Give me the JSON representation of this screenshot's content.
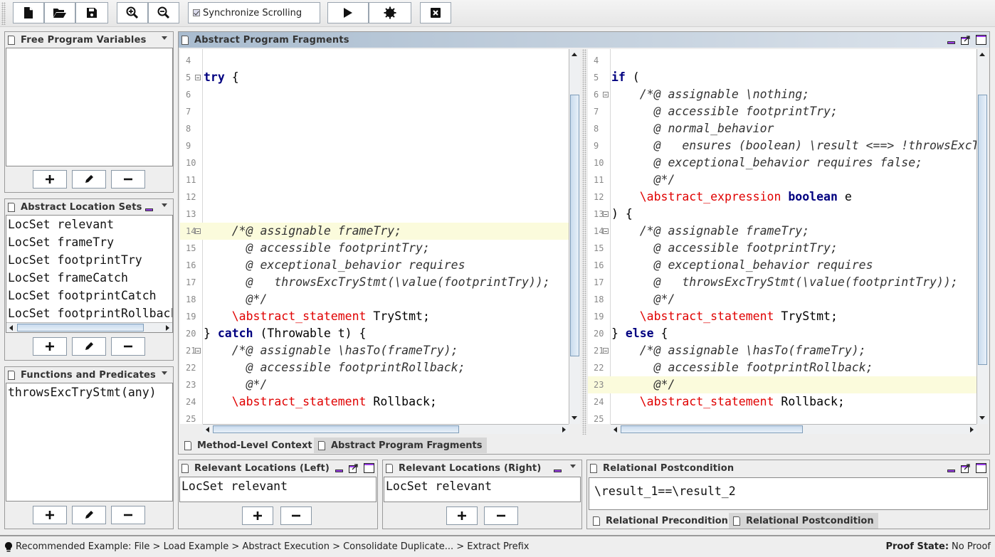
{
  "toolbar": {
    "buttons": [
      {
        "name": "new-file",
        "icon": "file-icon"
      },
      {
        "name": "open",
        "icon": "folder-open-icon"
      },
      {
        "name": "save",
        "icon": "floppy-disk-icon"
      },
      {
        "name": "zoom-in",
        "icon": "zoom-in-icon"
      },
      {
        "name": "zoom-out",
        "icon": "zoom-out-icon"
      },
      {
        "name": "run",
        "icon": "play-icon"
      },
      {
        "name": "settings",
        "icon": "cog-icon"
      },
      {
        "name": "close",
        "icon": "close-box-icon"
      }
    ],
    "sync_label": "Synchronize Scrolling",
    "sync_checked": true
  },
  "left": {
    "free_vars": {
      "title": "Free Program Variables",
      "items": []
    },
    "loc_sets": {
      "title": "Abstract Location Sets",
      "items": [
        "LocSet relevant",
        "LocSet frameTry",
        "LocSet footprintTry",
        "LocSet frameCatch",
        "LocSet footprintCatch",
        "LocSet footprintRollback"
      ]
    },
    "functions": {
      "title": "Functions and Predicates",
      "items": [
        "throwsExcTryStmt(any)"
      ]
    }
  },
  "main": {
    "title": "Abstract Program Fragments",
    "left_editor": {
      "lines": [
        {
          "n": "4",
          "code": []
        },
        {
          "n": "5",
          "fold": true,
          "code": [
            [
              "kw",
              "try"
            ],
            [
              "",
              "{"
            ]
          ]
        },
        {
          "n": "6",
          "code": []
        },
        {
          "n": "7",
          "code": []
        },
        {
          "n": "8",
          "code": []
        },
        {
          "n": "9",
          "code": []
        },
        {
          "n": "10",
          "code": []
        },
        {
          "n": "11",
          "code": []
        },
        {
          "n": "12",
          "code": []
        },
        {
          "n": "13",
          "code": []
        },
        {
          "n": "14",
          "fold": true,
          "hl": true,
          "code": [
            [
              "cm",
              "    /*@ assignable frameTry;"
            ]
          ]
        },
        {
          "n": "15",
          "code": [
            [
              "cm",
              "      @ accessible footprintTry;"
            ]
          ]
        },
        {
          "n": "16",
          "code": [
            [
              "cm",
              "      @ exceptional_behavior requires"
            ]
          ]
        },
        {
          "n": "17",
          "code": [
            [
              "cm",
              "      @   throwsExcTryStmt(\\value(footprintTry));"
            ]
          ]
        },
        {
          "n": "18",
          "code": [
            [
              "cm",
              "      @*/"
            ]
          ]
        },
        {
          "n": "19",
          "code": [
            [
              "ab",
              "    \\abstract_statement"
            ],
            [
              "",
              " TryStmt;"
            ]
          ]
        },
        {
          "n": "20",
          "code": [
            [
              "",
              "} "
            ],
            [
              "kw",
              "catch"
            ],
            [
              "",
              " (Throwable t) {"
            ]
          ]
        },
        {
          "n": "21",
          "fold": true,
          "code": [
            [
              "cm",
              "    /*@ assignable \\hasTo(frameTry);"
            ]
          ]
        },
        {
          "n": "22",
          "code": [
            [
              "cm",
              "      @ accessible footprintRollback;"
            ]
          ]
        },
        {
          "n": "23",
          "code": [
            [
              "cm",
              "      @*/"
            ]
          ]
        },
        {
          "n": "24",
          "code": [
            [
              "ab",
              "    \\abstract_statement"
            ],
            [
              "",
              " Rollback;"
            ]
          ]
        },
        {
          "n": "25",
          "code": []
        }
      ]
    },
    "right_editor": {
      "lines": [
        {
          "n": "4",
          "code": []
        },
        {
          "n": "5",
          "code": [
            [
              "kw",
              "if"
            ],
            [
              "",
              " ("
            ]
          ]
        },
        {
          "n": "6",
          "fold": true,
          "code": [
            [
              "cm",
              "    /*@ assignable \\nothing;"
            ]
          ]
        },
        {
          "n": "7",
          "code": [
            [
              "cm",
              "      @ accessible footprintTry;"
            ]
          ]
        },
        {
          "n": "8",
          "code": [
            [
              "cm",
              "      @ normal_behavior"
            ]
          ]
        },
        {
          "n": "9",
          "code": [
            [
              "cm",
              "      @   ensures (boolean) \\result <==> !throwsExcTryStmt"
            ]
          ]
        },
        {
          "n": "10",
          "code": [
            [
              "cm",
              "      @ exceptional_behavior requires false;"
            ]
          ]
        },
        {
          "n": "11",
          "code": [
            [
              "cm",
              "      @*/"
            ]
          ]
        },
        {
          "n": "12",
          "code": [
            [
              "ab",
              "    \\abstract_expression"
            ],
            [
              "",
              " "
            ],
            [
              "kw",
              "boolean"
            ],
            [
              "",
              " e"
            ]
          ]
        },
        {
          "n": "13",
          "fold": true,
          "code": [
            [
              "",
              ") {"
            ]
          ]
        },
        {
          "n": "14",
          "fold": true,
          "code": [
            [
              "cm",
              "    /*@ assignable frameTry;"
            ]
          ]
        },
        {
          "n": "15",
          "code": [
            [
              "cm",
              "      @ accessible footprintTry;"
            ]
          ]
        },
        {
          "n": "16",
          "code": [
            [
              "cm",
              "      @ exceptional_behavior requires"
            ]
          ]
        },
        {
          "n": "17",
          "code": [
            [
              "cm",
              "      @   throwsExcTryStmt(\\value(footprintTry));"
            ]
          ]
        },
        {
          "n": "18",
          "code": [
            [
              "cm",
              "      @*/"
            ]
          ]
        },
        {
          "n": "19",
          "code": [
            [
              "ab",
              "    \\abstract_statement"
            ],
            [
              "",
              " TryStmt;"
            ]
          ]
        },
        {
          "n": "20",
          "code": [
            [
              "",
              "} "
            ],
            [
              "kw",
              "else"
            ],
            [
              "",
              " {"
            ]
          ]
        },
        {
          "n": "21",
          "fold": true,
          "code": [
            [
              "cm",
              "    /*@ assignable \\hasTo(frameTry);"
            ]
          ]
        },
        {
          "n": "22",
          "code": [
            [
              "cm",
              "      @ accessible footprintRollback;"
            ]
          ]
        },
        {
          "n": "23",
          "hl": true,
          "code": [
            [
              "cm",
              "      @*/"
            ]
          ]
        },
        {
          "n": "24",
          "code": [
            [
              "ab",
              "    \\abstract_statement"
            ],
            [
              "",
              " Rollback;"
            ]
          ]
        },
        {
          "n": "25",
          "code": []
        }
      ]
    },
    "tabs": [
      {
        "label": "Method-Level Context",
        "selected": false
      },
      {
        "label": "Abstract Program Fragments",
        "selected": true
      }
    ]
  },
  "bottom": {
    "rel_left": {
      "title": "Relevant Locations (Left)",
      "items": [
        "LocSet relevant"
      ]
    },
    "rel_right": {
      "title": "Relevant Locations (Right)",
      "items": [
        "LocSet relevant"
      ]
    },
    "postcondition": {
      "title": "Relational Postcondition",
      "value": "\\result_1==\\result_2"
    },
    "cond_tabs": [
      {
        "label": "Relational Precondition",
        "selected": false
      },
      {
        "label": "Relational Postcondition",
        "selected": true
      }
    ]
  },
  "status": {
    "recommendation": "Recommended Example: File > Load Example > Abstract Execution > Consolidate Duplicate... > Extract Prefix",
    "proof_state_label": "Proof State:",
    "proof_state_value": "No Proof"
  },
  "colors": {
    "keyword": "#000080",
    "abstract": "#e00000",
    "highlight": "#fbfbdc",
    "active_title": "#a9bccf",
    "min_button": "#9a3ee8"
  }
}
